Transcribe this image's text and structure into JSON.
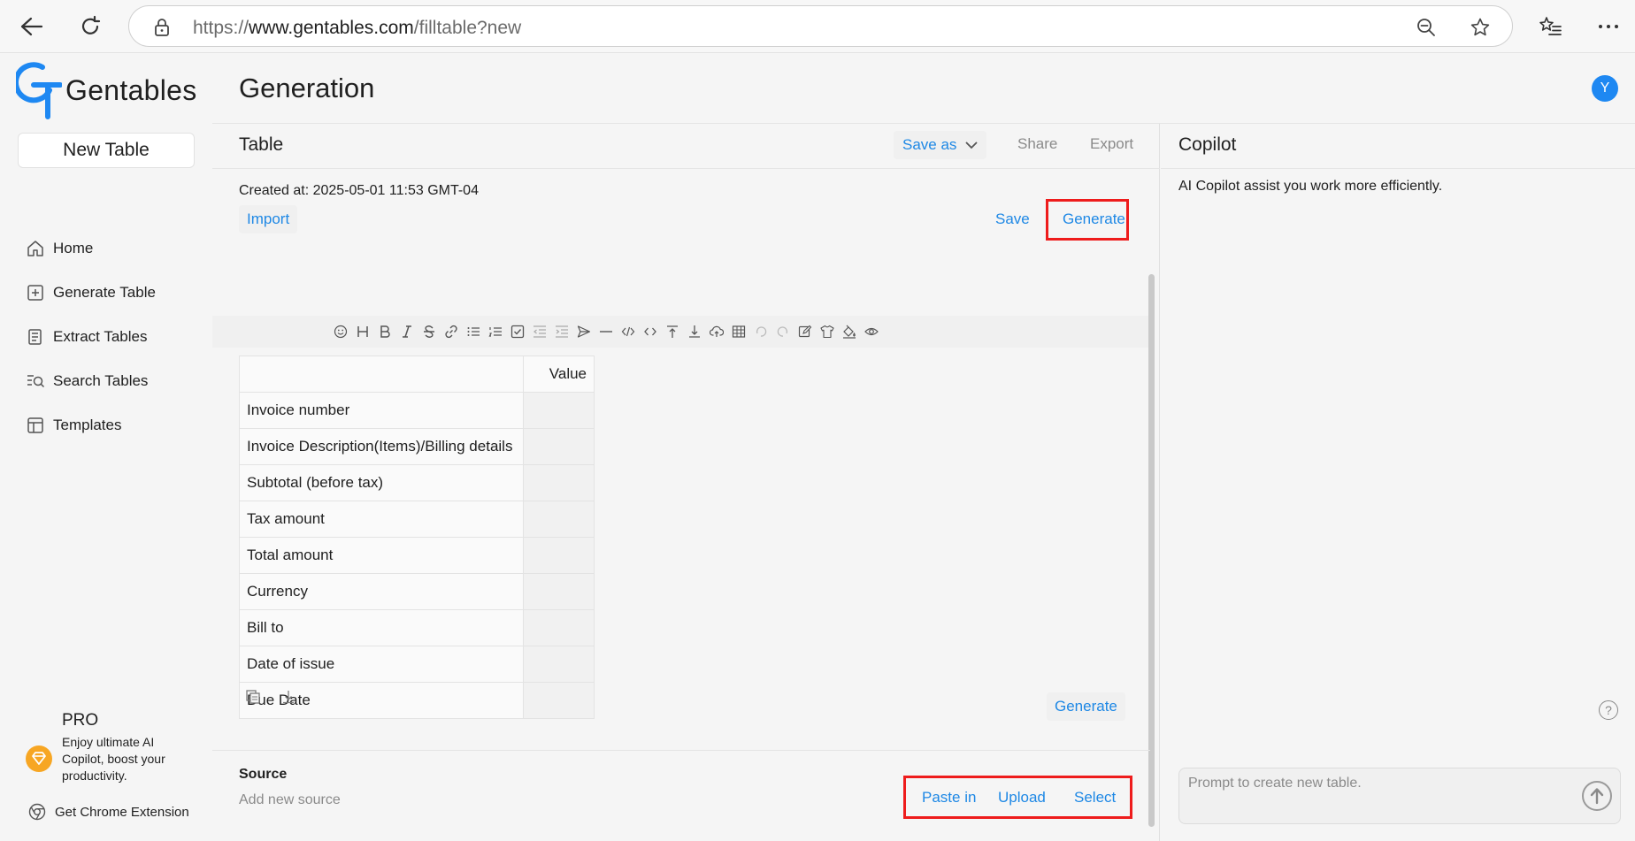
{
  "browser": {
    "url_prefix": "https://",
    "url_domain": "www.gentables.com",
    "url_path": "/filltable?new"
  },
  "app": {
    "logo_text": "Gentables",
    "new_table_label": "New Table",
    "sidebar": {
      "items": [
        {
          "label": "Home",
          "icon": "home-icon"
        },
        {
          "label": "Generate Table",
          "icon": "plus-square-icon"
        },
        {
          "label": "Extract Tables",
          "icon": "document-list-icon"
        },
        {
          "label": "Search Tables",
          "icon": "search-list-icon"
        },
        {
          "label": "Templates",
          "icon": "layout-icon"
        }
      ]
    },
    "pro": {
      "title": "PRO",
      "description": "Enjoy ultimate AI Copilot, boost your productivity."
    },
    "chrome_extension_label": "Get Chrome Extension"
  },
  "header": {
    "title": "Generation",
    "avatar_letter": "Y",
    "accent_color": "#1e88f2"
  },
  "table_panel": {
    "title": "Table",
    "save_as_label": "Save as",
    "share_label": "Share",
    "export_label": "Export",
    "created_at": "Created at: 2025-05-01 11:53 GMT-04",
    "import_label": "Import",
    "save_label": "Save",
    "generate_label": "Generate",
    "bottom_generate_label": "Generate",
    "table": {
      "header": [
        "",
        "Value"
      ],
      "rows": [
        "Invoice number",
        "Invoice Description(Items)/Billing details",
        "Subtotal (before tax)",
        "Tax amount",
        "Total amount",
        "Currency",
        "Bill to",
        "Date of issue",
        "Due Date"
      ]
    },
    "source": {
      "label": "Source",
      "placeholder": "Add new source",
      "paste_label": "Paste in",
      "upload_label": "Upload",
      "select_label": "Select"
    }
  },
  "copilot": {
    "title": "Copilot",
    "description": "AI Copilot assist you work more efficiently.",
    "prompt_placeholder": "Prompt to create new table.",
    "help_symbol": "?"
  }
}
